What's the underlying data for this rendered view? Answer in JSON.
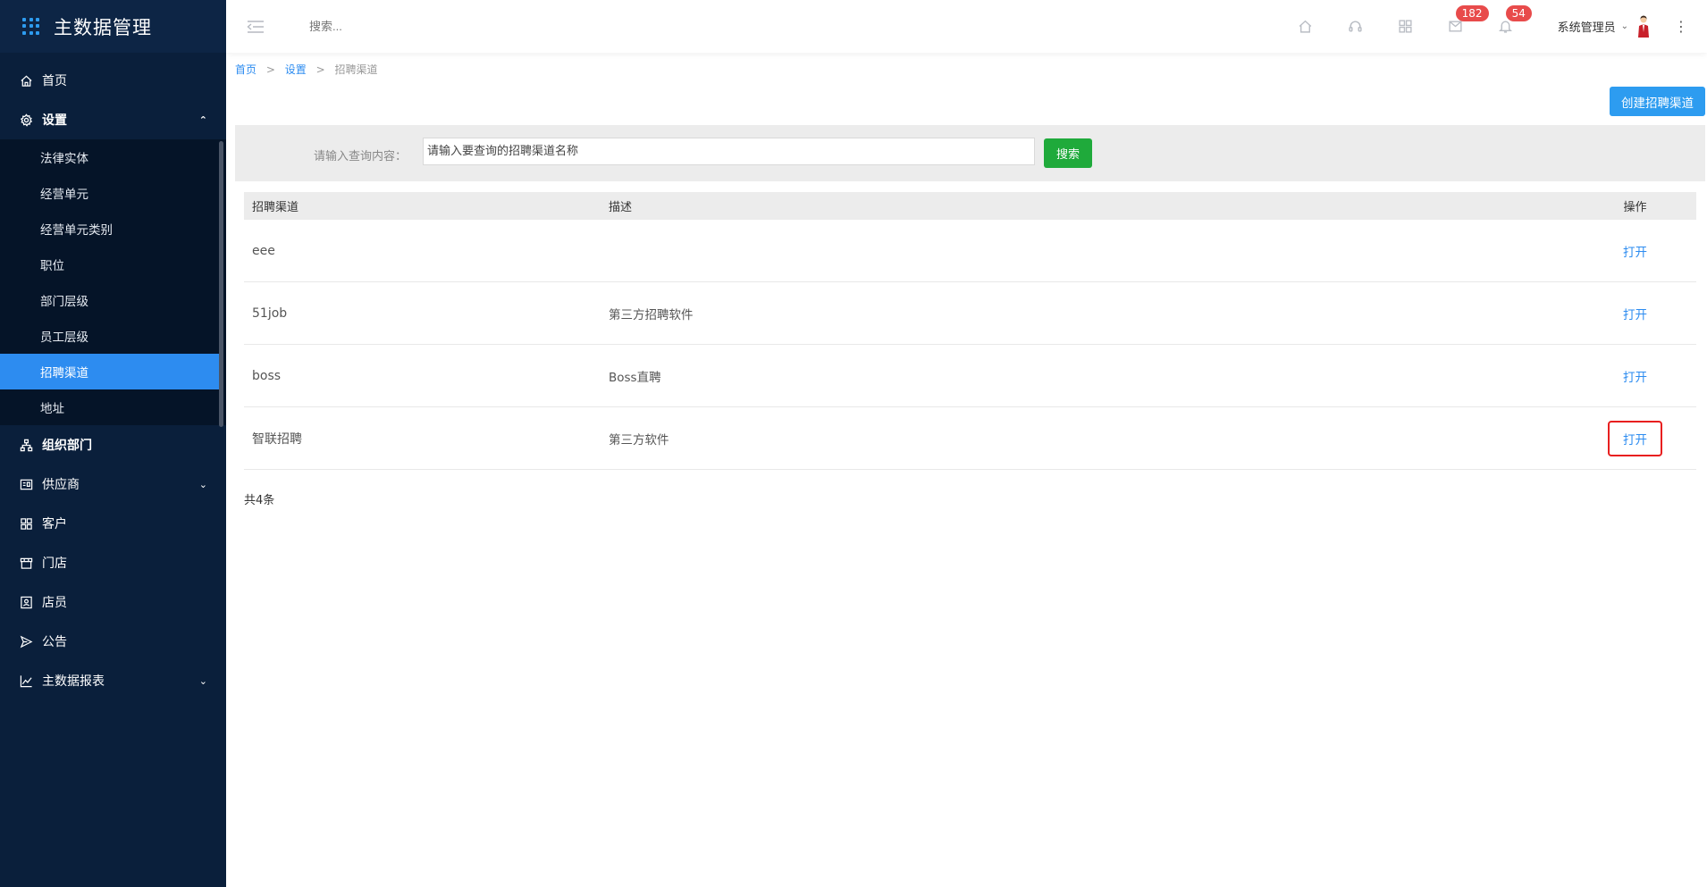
{
  "app": {
    "title": "主数据管理"
  },
  "sidebar": {
    "items": [
      {
        "label": "首页",
        "icon": "home-icon"
      },
      {
        "label": "设置",
        "icon": "gear-icon",
        "open": true,
        "children": [
          "法律实体",
          "经营单元",
          "经营单元类别",
          "职位",
          "部门层级",
          "员工层级",
          "招聘渠道",
          "地址"
        ],
        "active_child": "招聘渠道"
      },
      {
        "label": "组织部门",
        "icon": "org-chart-icon"
      },
      {
        "label": "供应商",
        "icon": "supplier-icon",
        "has_children": true
      },
      {
        "label": "客户",
        "icon": "customer-icon"
      },
      {
        "label": "门店",
        "icon": "store-icon"
      },
      {
        "label": "店员",
        "icon": "clerk-icon"
      },
      {
        "label": "公告",
        "icon": "announcement-icon"
      },
      {
        "label": "主数据报表",
        "icon": "report-icon",
        "has_children": true
      }
    ]
  },
  "header": {
    "search_placeholder": "搜索...",
    "icons": [
      "home-icon",
      "headset-icon",
      "grid-icon",
      "message-icon",
      "bell-icon"
    ],
    "message_badge": "182",
    "notification_badge": "54",
    "user_name": "系统管理员"
  },
  "breadcrumb": {
    "home": "首页",
    "settings": "设置",
    "current": "招聘渠道",
    "separator": ">"
  },
  "toolbar": {
    "create_label": "创建招聘渠道"
  },
  "filter": {
    "label": "请输入查询内容：",
    "placeholder": "请输入要查询的招聘渠道名称",
    "search_label": "搜索"
  },
  "table": {
    "headers": [
      "招聘渠道",
      "描述",
      "操作"
    ],
    "rows": [
      {
        "channel": "eee",
        "description": "",
        "action": "打开"
      },
      {
        "channel": "51job",
        "description": "第三方招聘软件",
        "action": "打开"
      },
      {
        "channel": "boss",
        "description": "Boss直聘",
        "action": "打开"
      },
      {
        "channel": "智联招聘",
        "description": "第三方软件",
        "action": "打开"
      }
    ],
    "total": "共4条"
  },
  "colors": {
    "sidebar_bg": "#0a1f3b",
    "accent": "#2d8cf0",
    "search_btn": "#1faa3b",
    "badge": "#e84b4b",
    "highlight": "#e81f1f"
  }
}
